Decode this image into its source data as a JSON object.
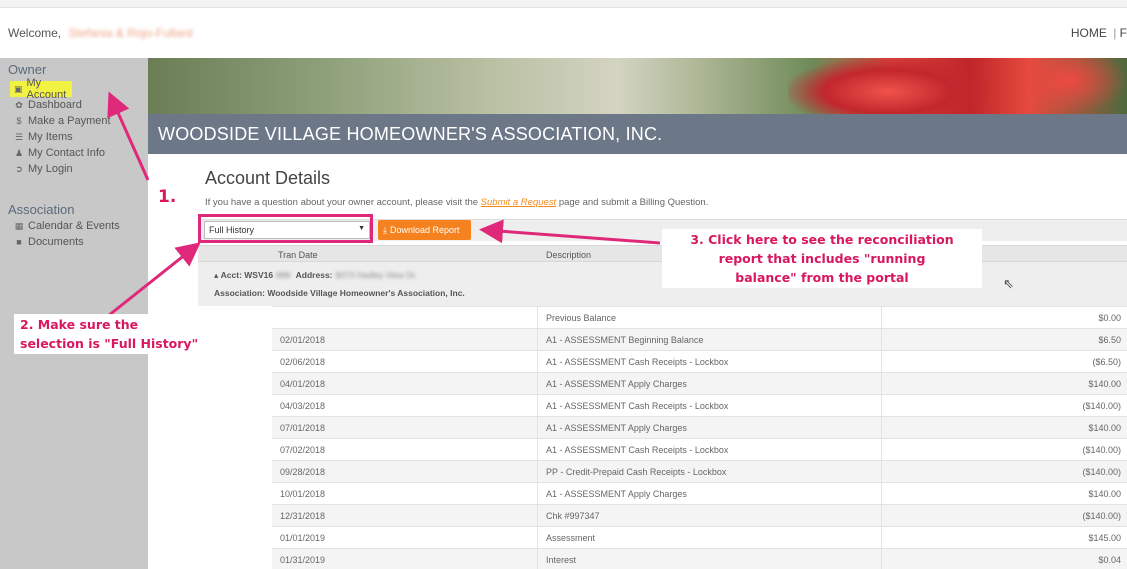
{
  "header": {
    "welcome_label": "Welcome,",
    "user_name_blurred": "Stefania & Rojo-Fullard",
    "nav": [
      "HOME",
      "F"
    ]
  },
  "sidebar": {
    "owner_heading": "Owner",
    "owner_items": [
      {
        "label": "My Account",
        "icon": "account-icon"
      },
      {
        "label": "Dashboard",
        "icon": "dashboard-icon"
      },
      {
        "label": "Make a Payment",
        "icon": "dollar-icon"
      },
      {
        "label": "My Items",
        "icon": "list-icon"
      },
      {
        "label": "My Contact Info",
        "icon": "user-icon"
      },
      {
        "label": "My Login",
        "icon": "login-icon"
      }
    ],
    "association_heading": "Association",
    "association_items": [
      {
        "label": "Calendar & Events",
        "icon": "calendar-icon"
      },
      {
        "label": "Documents",
        "icon": "folder-icon"
      }
    ]
  },
  "banner": {
    "title": "WOODSIDE VILLAGE HOMEOWNER'S ASSOCIATION, INC."
  },
  "main": {
    "page_title": "Account Details",
    "intro_before": "If you have a question about your owner account, please visit the ",
    "intro_link": "Submit a Request",
    "intro_after": " page and submit a Billing Question.",
    "filter_selected": "Full History",
    "download_label": "Download Report",
    "columns": [
      "Tran Date",
      "Description"
    ],
    "acct_label": "Acct: WSV16",
    "address_label": "Address:",
    "association_line": "Association: Woodside Village Homeowner's Association, Inc.",
    "rows": [
      {
        "date": "",
        "desc": "Previous Balance",
        "amount": "$0.00"
      },
      {
        "date": "02/01/2018",
        "desc": "A1 - ASSESSMENT Beginning Balance",
        "amount": "$6.50"
      },
      {
        "date": "02/06/2018",
        "desc": "A1 - ASSESSMENT Cash Receipts - Lockbox",
        "amount": "($6.50)"
      },
      {
        "date": "04/01/2018",
        "desc": "A1 - ASSESSMENT Apply Charges",
        "amount": "$140.00"
      },
      {
        "date": "04/03/2018",
        "desc": "A1 - ASSESSMENT Cash Receipts - Lockbox",
        "amount": "($140.00)"
      },
      {
        "date": "07/01/2018",
        "desc": "A1 - ASSESSMENT Apply Charges",
        "amount": "$140.00"
      },
      {
        "date": "07/02/2018",
        "desc": "A1 - ASSESSMENT Cash Receipts - Lockbox",
        "amount": "($140.00)"
      },
      {
        "date": "09/28/2018",
        "desc": "PP - Credit-Prepaid Cash Receipts - Lockbox",
        "amount": "($140.00)"
      },
      {
        "date": "10/01/2018",
        "desc": "A1 - ASSESSMENT Apply Charges",
        "amount": "$140.00"
      },
      {
        "date": "12/31/2018",
        "desc": "Chk #997347",
        "amount": "($140.00)"
      },
      {
        "date": "01/01/2019",
        "desc": "Assessment",
        "amount": "$145.00"
      },
      {
        "date": "01/31/2019",
        "desc": "Interest",
        "amount": "$0.04"
      }
    ]
  },
  "annotations": {
    "step1": "1.",
    "step2_line1": "2. Make sure the",
    "step2_line2": "selection is \"Full History\"",
    "step3_line1": "3. Click here to see the reconciliation",
    "step3_line2": "report that includes \"running",
    "step3_line3": "balance\" from the portal",
    "color": "#e0287a"
  }
}
